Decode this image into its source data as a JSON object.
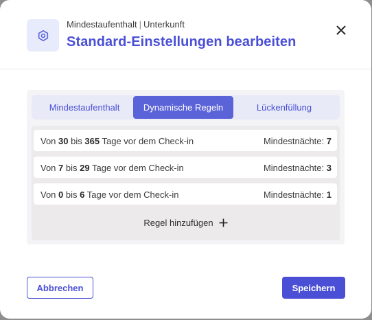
{
  "header": {
    "breadcrumb_part1": "Mindestaufenthalt",
    "breadcrumb_separator": "|",
    "breadcrumb_part2": "Unterkunft",
    "title": "Standard-Einstellungen bearbeiten",
    "icon": "settings-hexagon-icon",
    "close_icon": "close-icon"
  },
  "tabs": [
    {
      "label": "Mindestaufenthalt",
      "active": false
    },
    {
      "label": "Dynamische Regeln",
      "active": true
    },
    {
      "label": "Lückenfüllung",
      "active": false
    }
  ],
  "rules": [
    {
      "from_word": "Von",
      "from": "30",
      "to_word": "bis",
      "to": "365",
      "suffix": "Tage vor dem Check-in",
      "min_label": "Mindestnächte:",
      "min_value": "7"
    },
    {
      "from_word": "Von",
      "from": "7",
      "to_word": "bis",
      "to": "29",
      "suffix": "Tage vor dem Check-in",
      "min_label": "Mindestnächte:",
      "min_value": "3"
    },
    {
      "from_word": "Von",
      "from": "0",
      "to_word": "bis",
      "to": "6",
      "suffix": "Tage vor dem Check-in",
      "min_label": "Mindestnächte:",
      "min_value": "1"
    }
  ],
  "add_rule": {
    "label": "Regel hinzufügen",
    "icon": "plus-icon"
  },
  "footer": {
    "cancel_label": "Abbrechen",
    "save_label": "Speichern"
  },
  "colors": {
    "accent": "#4a4fd6",
    "active_tab": "#5b63d9",
    "icon_bg": "#e7ebfb"
  }
}
